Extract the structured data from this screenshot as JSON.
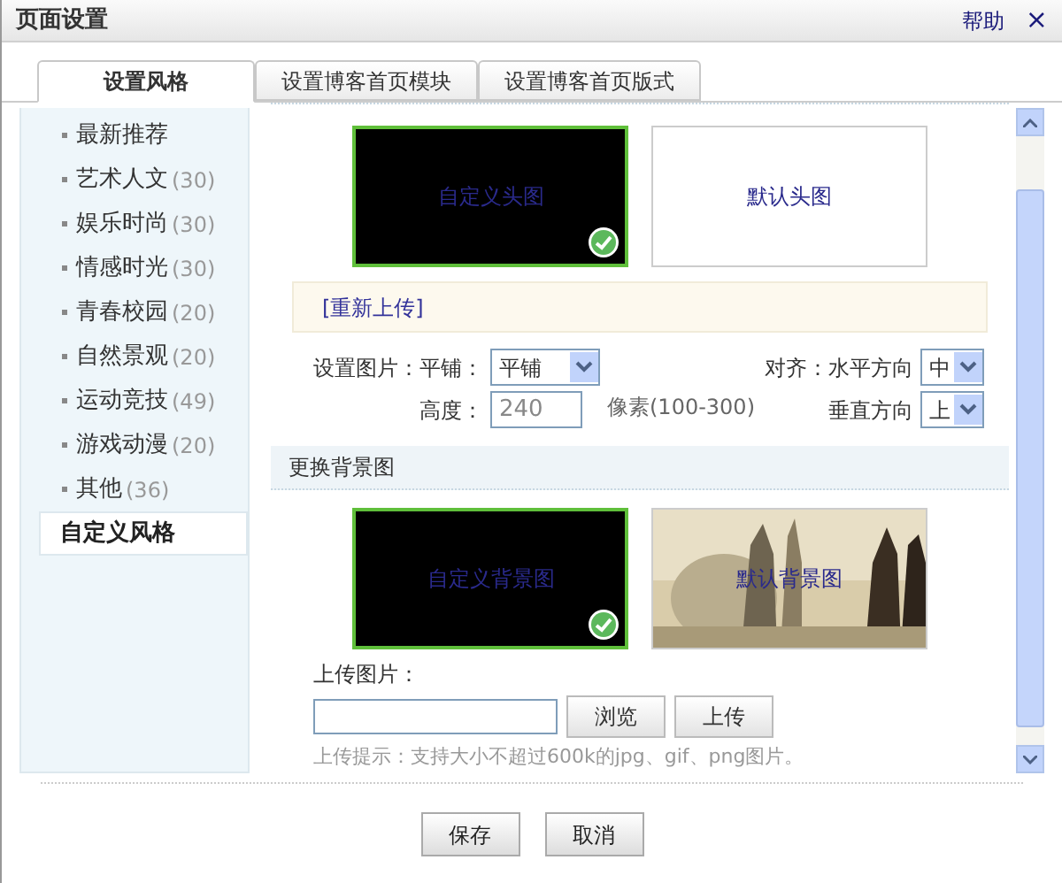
{
  "window": {
    "title": "页面设置",
    "help": "帮助",
    "close": "×"
  },
  "tabs": [
    {
      "label": "设置风格",
      "selected": true
    },
    {
      "label": "设置博客首页模块",
      "selected": false
    },
    {
      "label": "设置博客首页版式",
      "selected": false
    }
  ],
  "sidebar": {
    "items": [
      {
        "label": "最新推荐",
        "selected": false
      },
      {
        "label": "艺术人文",
        "count": "(30)",
        "selected": false
      },
      {
        "label": "娱乐时尚",
        "count": "(30)",
        "selected": false
      },
      {
        "label": "情感时光",
        "count": "(30)",
        "selected": false
      },
      {
        "label": "青春校园",
        "count": "(20)",
        "selected": false
      },
      {
        "label": "自然景观",
        "count": "(20)",
        "selected": false
      },
      {
        "label": "运动竞技",
        "count": "(49)",
        "selected": false
      },
      {
        "label": "游戏动漫",
        "count": "(20)",
        "selected": false
      },
      {
        "label": "其他",
        "count": "(36)",
        "selected": false
      },
      {
        "label": "自定义风格",
        "selected": true
      }
    ]
  },
  "header_images": [
    {
      "label": "自定义头图",
      "kind": "dark",
      "selected": true
    },
    {
      "label": "默认头图",
      "kind": "blank",
      "selected": false
    }
  ],
  "reupload_link": "[重新上传]",
  "settings": {
    "label": "设置图片：",
    "tile_label": "平铺：",
    "tile_value": "平铺",
    "align_label": "对齐：水平方向",
    "horizontal_value": "中",
    "height_label": "高度：",
    "height_value": "240",
    "height_hint": "像素(100-300)",
    "vertical_label": "垂直方向",
    "vertical_value": "上"
  },
  "background_section": {
    "title": "更换背景图"
  },
  "background_images": [
    {
      "label": "自定义背景图",
      "kind": "dark",
      "selected": true
    },
    {
      "label": "默认背景图",
      "kind": "picture",
      "selected": false
    }
  ],
  "upload": {
    "label": "上传图片：",
    "browse_button": "浏览",
    "upload_button": "上传",
    "hint": "上传提示：支持大小不超过600k的jpg、gif、png图片。"
  },
  "buttons": [
    "保存",
    "取消"
  ]
}
